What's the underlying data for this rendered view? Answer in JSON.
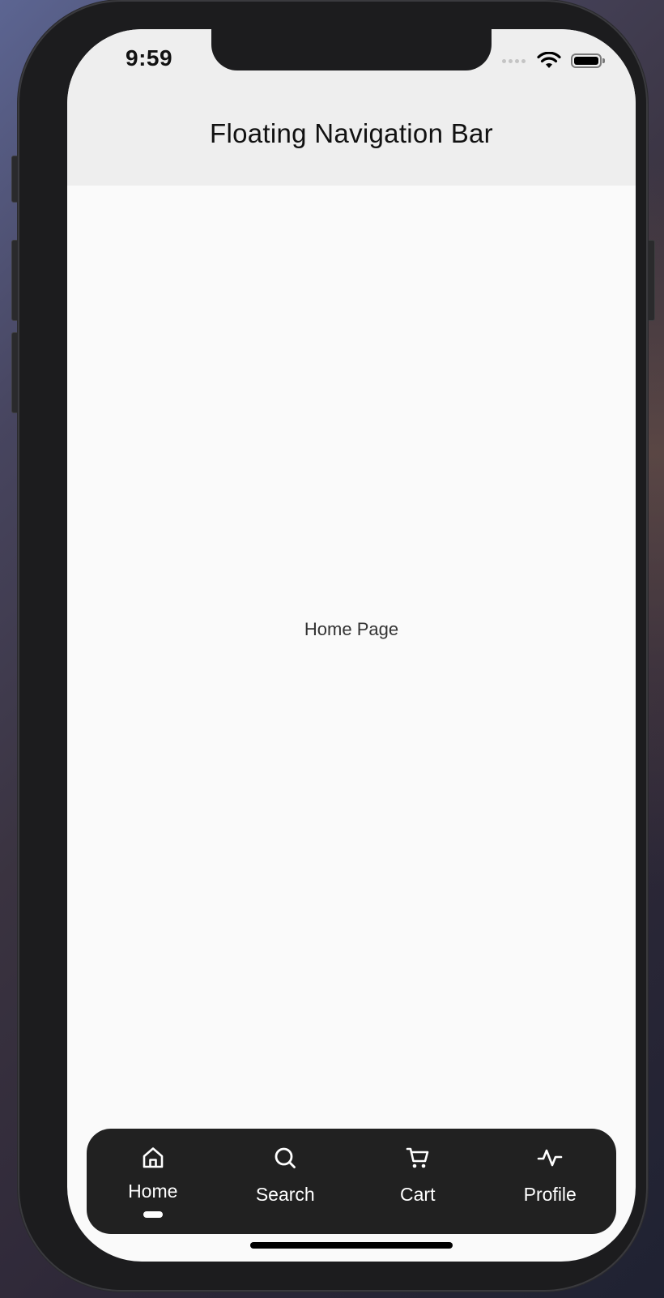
{
  "status_bar": {
    "time": "9:59"
  },
  "app_bar": {
    "title": "Floating Navigation Bar"
  },
  "page": {
    "content": "Home Page"
  },
  "nav": {
    "active_index": 0,
    "items": [
      {
        "label": "Home",
        "icon": "home-icon"
      },
      {
        "label": "Search",
        "icon": "search-icon"
      },
      {
        "label": "Cart",
        "icon": "cart-icon"
      },
      {
        "label": "Profile",
        "icon": "activity-icon"
      }
    ]
  },
  "colors": {
    "app_bar_bg": "#eeeeee",
    "page_bg": "#fafafa",
    "nav_bg": "#212121",
    "nav_fg": "#ffffff"
  }
}
